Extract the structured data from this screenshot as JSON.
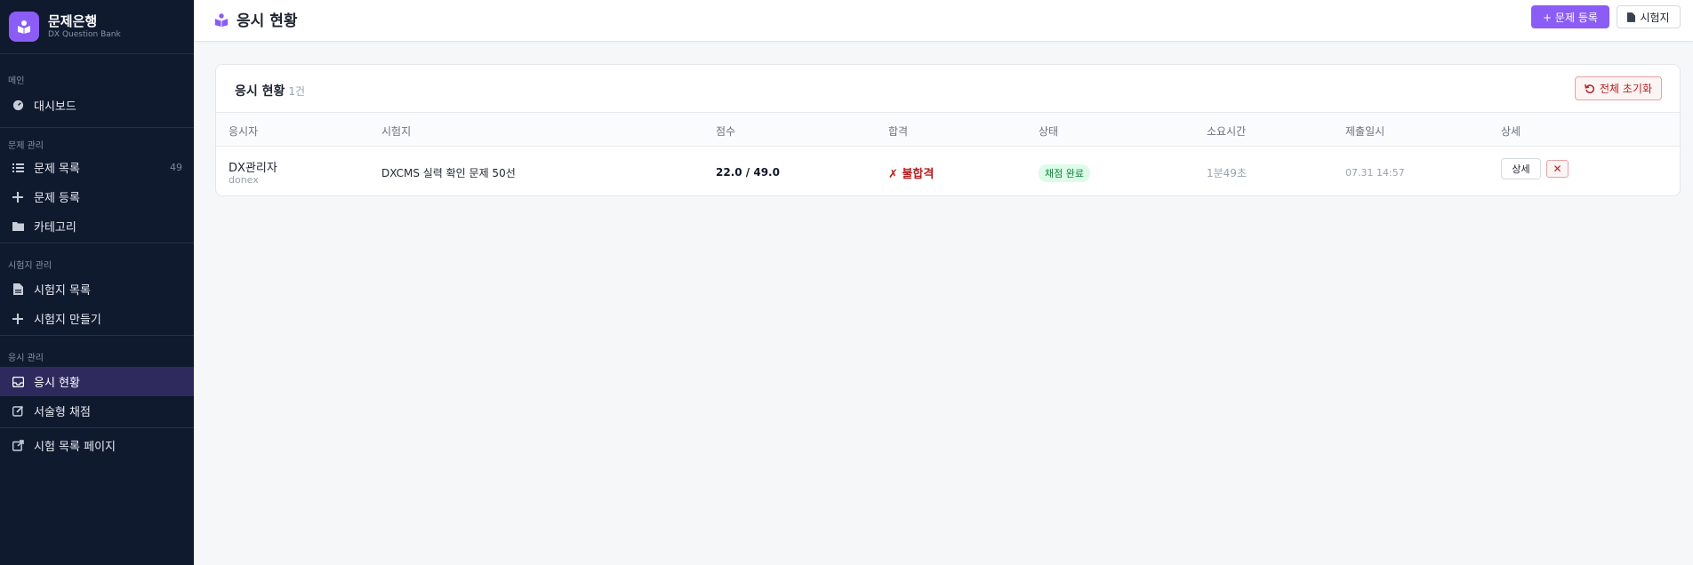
{
  "brand": {
    "title": "문제은행",
    "subtitle": "DX Question Bank"
  },
  "sidebar": {
    "sections": [
      {
        "label": "메인",
        "items": [
          {
            "label": "대시보드",
            "icon": "dashboard-icon"
          }
        ]
      },
      {
        "label": "문제 관리",
        "items": [
          {
            "label": "문제 목록",
            "icon": "list-icon",
            "count": "49"
          },
          {
            "label": "문제 등록",
            "icon": "plus-icon"
          },
          {
            "label": "카테고리",
            "icon": "folder-icon"
          }
        ]
      },
      {
        "label": "시험지 관리",
        "items": [
          {
            "label": "시험지 목록",
            "icon": "file-icon"
          },
          {
            "label": "시험지 만들기",
            "icon": "plus-icon"
          }
        ]
      },
      {
        "label": "응시 관리",
        "items": [
          {
            "label": "응시 현황",
            "icon": "inbox-icon",
            "active": true
          },
          {
            "label": "서술형 채점",
            "icon": "edit-icon"
          }
        ]
      }
    ],
    "external": {
      "label": "시험 목록 페이지",
      "icon": "external-link-icon"
    }
  },
  "header": {
    "title": "응시 현황",
    "primary_button": "+ 문제 등록",
    "secondary_button": "시험지"
  },
  "card": {
    "title": "응시 현황",
    "count": "1건",
    "reset_button": "전체 초기화"
  },
  "table": {
    "columns": [
      "응시자",
      "시험지",
      "점수",
      "합격",
      "상태",
      "소요시간",
      "제출일시",
      "상세"
    ],
    "rows": [
      {
        "name": "DX관리자",
        "user_id": "donex",
        "exam": "DXCMS 실력 확인 문제 50선",
        "score": "22.0 / 49.0",
        "result": "✗ 불합격",
        "status": "채점 완료",
        "duration": "1분49초",
        "submitted": "07.31 14:57",
        "detail_button": "상세",
        "delete_button": "✕"
      }
    ]
  },
  "colors": {
    "accent": "#8b5cf6",
    "sidebar_bg": "#101a2f",
    "danger": "#b42323",
    "success": "#15803d"
  }
}
